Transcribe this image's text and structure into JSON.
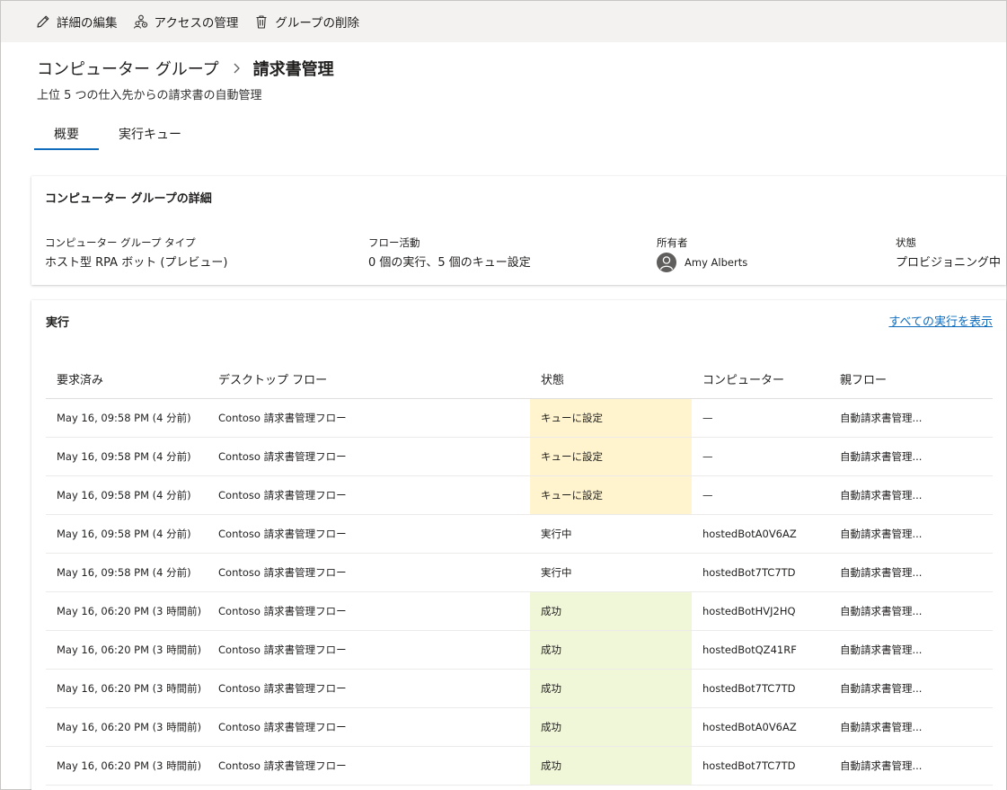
{
  "toolbar": {
    "edit_label": "詳細の編集",
    "access_label": "アクセスの管理",
    "delete_label": "グループの削除"
  },
  "breadcrumb": {
    "parent": "コンピューター グループ",
    "current": "請求書管理"
  },
  "subtitle": "上位 5 つの仕入先からの請求書の自動管理",
  "tabs": [
    {
      "label": "概要",
      "active": true
    },
    {
      "label": "実行キュー",
      "active": false
    }
  ],
  "details": {
    "title": "コンピューター グループの詳細",
    "type_label": "コンピューター グループ タイプ",
    "type_value": "ホスト型 RPA ボット (プレビュー)",
    "activity_label": "フロー活動",
    "activity_value": "0 個の実行、5 個のキュー設定",
    "owner_label": "所有者",
    "owner_value": "Amy Alberts",
    "status_label": "状態",
    "status_value": "プロビジョニング中"
  },
  "runs": {
    "title": "実行",
    "view_all": "すべての実行を表示",
    "columns": [
      "要求済み",
      "デスクトップ フロー",
      "状態",
      "コンピューター",
      "親フロー"
    ],
    "rows": [
      {
        "requested": "May 16, 09:58 PM (4 分前)",
        "flow": "Contoso 請求書管理フロー",
        "status": "キューに設定",
        "status_type": "queued",
        "machine": "—",
        "parent": "自動請求書管理..."
      },
      {
        "requested": "May 16, 09:58 PM (4 分前)",
        "flow": "Contoso 請求書管理フロー",
        "status": "キューに設定",
        "status_type": "queued",
        "machine": "—",
        "parent": "自動請求書管理..."
      },
      {
        "requested": "May 16, 09:58 PM (4 分前)",
        "flow": "Contoso 請求書管理フロー",
        "status": "キューに設定",
        "status_type": "queued",
        "machine": "—",
        "parent": "自動請求書管理..."
      },
      {
        "requested": "May 16, 09:58 PM (4 分前)",
        "flow": "Contoso 請求書管理フロー",
        "status": "実行中",
        "status_type": "running",
        "machine": "hostedBotA0V6AZ",
        "parent": "自動請求書管理..."
      },
      {
        "requested": "May 16, 09:58 PM (4 分前)",
        "flow": "Contoso 請求書管理フロー",
        "status": "実行中",
        "status_type": "running",
        "machine": "hostedBot7TC7TD",
        "parent": "自動請求書管理..."
      },
      {
        "requested": "May 16, 06:20 PM (3 時間前)",
        "flow": "Contoso 請求書管理フロー",
        "status": "成功",
        "status_type": "success",
        "machine": "hostedBotHVJ2HQ",
        "parent": "自動請求書管理..."
      },
      {
        "requested": "May 16, 06:20 PM (3 時間前)",
        "flow": "Contoso 請求書管理フロー",
        "status": "成功",
        "status_type": "success",
        "machine": "hostedBotQZ41RF",
        "parent": "自動請求書管理..."
      },
      {
        "requested": "May 16, 06:20 PM (3 時間前)",
        "flow": "Contoso 請求書管理フロー",
        "status": "成功",
        "status_type": "success",
        "machine": "hostedBot7TC7TD",
        "parent": "自動請求書管理..."
      },
      {
        "requested": "May 16, 06:20 PM (3 時間前)",
        "flow": "Contoso 請求書管理フロー",
        "status": "成功",
        "status_type": "success",
        "machine": "hostedBotA0V6AZ",
        "parent": "自動請求書管理..."
      },
      {
        "requested": "May 16, 06:20 PM (3 時間前)",
        "flow": "Contoso 請求書管理フロー",
        "status": "成功",
        "status_type": "success",
        "machine": "hostedBot7TC7TD",
        "parent": "自動請求書管理..."
      }
    ]
  },
  "colors": {
    "accent": "#0f6cbd",
    "queued_bg": "#fff4ce",
    "success_bg": "#f0f6d8",
    "toolbar_bg": "#f3f2f1"
  },
  "icons": {
    "edit": "pencil-icon",
    "access": "people-settings-icon",
    "delete": "trash-icon",
    "breadcrumb_sep": "chevron-right-icon",
    "owner": "person-icon"
  }
}
